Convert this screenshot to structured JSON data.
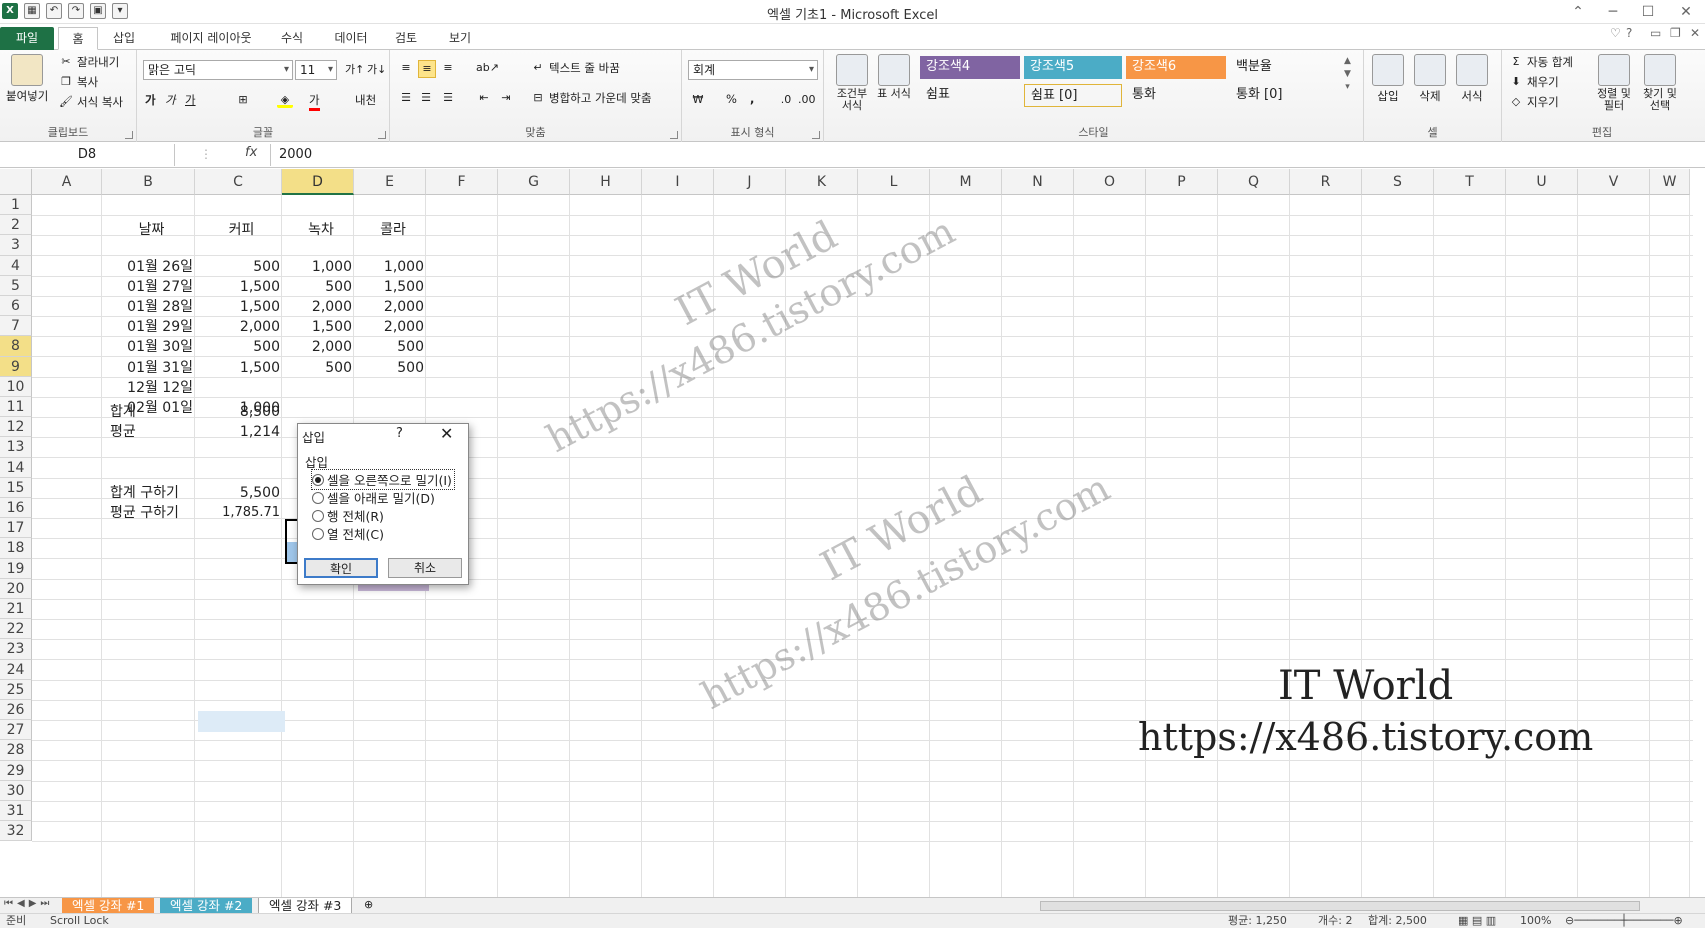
{
  "window": {
    "title": "엑셀 기초1 - Microsoft Excel"
  },
  "ribbon_tabs": [
    "파일",
    "홈",
    "삽입",
    "페이지 레이아웃",
    "수식",
    "데이터",
    "검토",
    "보기"
  ],
  "clipboard": {
    "paste": "붙여넣기",
    "cut": "잘라내기",
    "copy": "복사",
    "format_painter": "서식 복사",
    "label": "클립보드"
  },
  "font": {
    "name": "맑은 고딕",
    "size": "11",
    "bold": "가",
    "italic": "가",
    "underline": "가",
    "color_a": "가",
    "label": "글꼴",
    "phonetic": "내천"
  },
  "alignment": {
    "wrap": "텍스트 줄 바꿈",
    "merge": "병합하고 가운데 맞춤",
    "label": "맞춤"
  },
  "number": {
    "format": "회계",
    "percent": "%",
    "comma": ",",
    "label": "표시 형식"
  },
  "styles_group": {
    "conditional": "조건부 서식",
    "table": "표 서식",
    "label": "스타일",
    "items": [
      {
        "name": "강조색4",
        "color": "#8064a2"
      },
      {
        "name": "강조색5",
        "color": "#4bacc6"
      },
      {
        "name": "강조색6",
        "color": "#f79646"
      },
      {
        "name": "백분율",
        "color": "#ffffff"
      },
      {
        "name": "쉼표",
        "color": "#ffffff"
      },
      {
        "name": "쉼표 [0]",
        "color": "#ffffff"
      },
      {
        "name": "통화",
        "color": "#ffffff"
      },
      {
        "name": "통화 [0]",
        "color": "#ffffff"
      }
    ]
  },
  "cells_group": {
    "insert": "삽입",
    "delete": "삭제",
    "format": "서식",
    "label": "셀"
  },
  "editing": {
    "autosum": "자동 합계",
    "fill": "채우기",
    "clear": "지우기",
    "sort": "정렬 및 필터",
    "find": "찾기 및 선택",
    "label": "편집"
  },
  "formula_bar": {
    "name_box": "D8",
    "fx": "fx",
    "value": "2000"
  },
  "columns": [
    "A",
    "B",
    "C",
    "D",
    "E",
    "F",
    "G",
    "H",
    "I",
    "J",
    "K",
    "L",
    "M",
    "N",
    "O",
    "P",
    "Q",
    "R",
    "S",
    "T",
    "U",
    "V",
    "W"
  ],
  "rows": [
    "1",
    "2",
    "3",
    "4",
    "5",
    "6",
    "7",
    "8",
    "9",
    "10",
    "11",
    "12",
    "13",
    "14",
    "15",
    "16",
    "17",
    "18",
    "19",
    "20",
    "21",
    "22",
    "23",
    "24",
    "25",
    "26",
    "27",
    "28",
    "29",
    "30",
    "31",
    "32"
  ],
  "headers": {
    "date": "날짜",
    "coffee": "커피",
    "tea": "녹차",
    "cola": "콜라"
  },
  "data_rows": [
    {
      "date": "01월 26일",
      "coffee": "500",
      "tea": "1,000",
      "cola": "1,000"
    },
    {
      "date": "01월 27일",
      "coffee": "1,500",
      "tea": "500",
      "cola": "1,500"
    },
    {
      "date": "01월 28일",
      "coffee": "1,500",
      "tea": "2,000",
      "cola": "2,000"
    },
    {
      "date": "01월 29일",
      "coffee": "2,000",
      "tea": "1,500",
      "cola": "2,000"
    },
    {
      "date": "01월 30일",
      "coffee": "500",
      "tea": "2,000",
      "cola": "500"
    },
    {
      "date": "01월 31일",
      "coffee": "1,500",
      "tea": "500",
      "cola": "500"
    },
    {
      "date": "12월 12일",
      "coffee": "",
      "tea": "",
      "cola": ""
    },
    {
      "date": "02월 01일",
      "coffee": "1,000",
      "tea": "",
      "cola": ""
    }
  ],
  "summary": {
    "total_label": "합계",
    "total_value": "8,500",
    "avg_label": "평균",
    "avg_value": "1,214",
    "sum_calc_label": "합계 구하기",
    "sum_calc_value": "5,500",
    "avg_calc_label": "평균 구하기",
    "avg_calc_value": "1,785.71"
  },
  "dialog": {
    "title": "삽입",
    "help": "?",
    "group": "삽입",
    "options": [
      "셀을 오른쪽으로 밀기(I)",
      "셀을 아래로 밀기(D)",
      "행 전체(R)",
      "열 전체(C)"
    ],
    "selected": 0,
    "ok": "확인",
    "cancel": "취소"
  },
  "watermarks": {
    "brand": "IT World",
    "url": "https://x486.tistory.com"
  },
  "sheet_tabs": [
    "엑셀 강좌 #1",
    "엑셀 강좌 #2",
    "엑셀 강좌 #3"
  ],
  "status": {
    "ready": "준비",
    "scroll_lock": "Scroll Lock",
    "average": "평균: 1,250",
    "count": "개수: 2",
    "sum": "합계: 2,500",
    "zoom": "100%"
  }
}
